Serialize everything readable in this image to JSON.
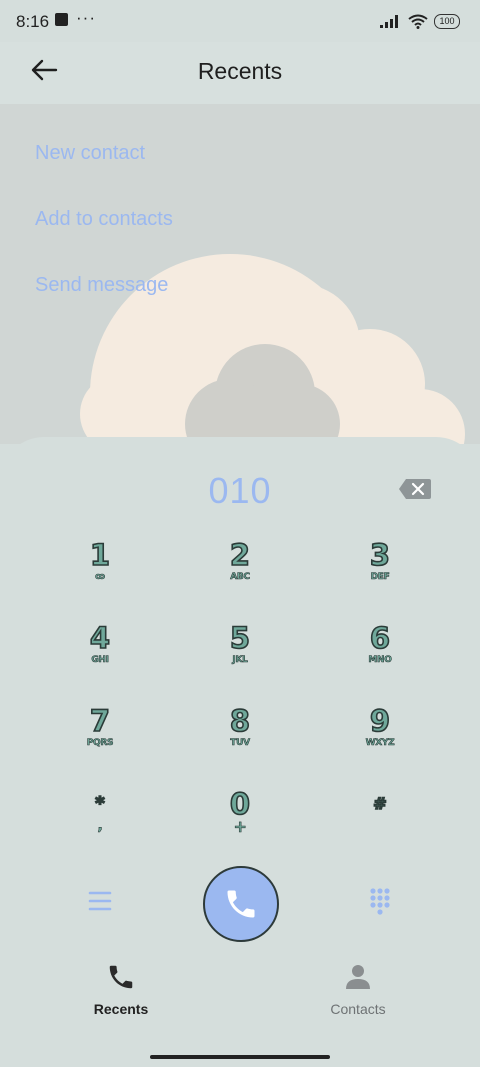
{
  "status_bar": {
    "time": "8:16",
    "more": "···",
    "battery": "100"
  },
  "header": {
    "title": "Recents",
    "back_icon": "arrow-left-icon"
  },
  "menu": {
    "items": [
      {
        "label": "New contact"
      },
      {
        "label": "Add to contacts"
      },
      {
        "label": "Send message"
      }
    ]
  },
  "dialer": {
    "number": "010",
    "keys": [
      {
        "digit": "1",
        "letters": "ꝏ"
      },
      {
        "digit": "2",
        "letters": "ABC"
      },
      {
        "digit": "3",
        "letters": "DEF"
      },
      {
        "digit": "4",
        "letters": "GHI"
      },
      {
        "digit": "5",
        "letters": "JKL"
      },
      {
        "digit": "6",
        "letters": "MNO"
      },
      {
        "digit": "7",
        "letters": "PQRS"
      },
      {
        "digit": "8",
        "letters": "TUV"
      },
      {
        "digit": "9",
        "letters": "WXYZ"
      },
      {
        "digit": "*",
        "letters": ","
      },
      {
        "digit": "0",
        "letters": "+"
      },
      {
        "digit": "#",
        "letters": ""
      }
    ]
  },
  "bottom_nav": {
    "tabs": [
      {
        "label": "Recents",
        "icon": "phone-icon"
      },
      {
        "label": "Contacts",
        "icon": "person-icon"
      }
    ]
  },
  "colors": {
    "accent": "#9bb8f0",
    "key_fill": "#6fa89a",
    "background": "#d5dedc"
  }
}
